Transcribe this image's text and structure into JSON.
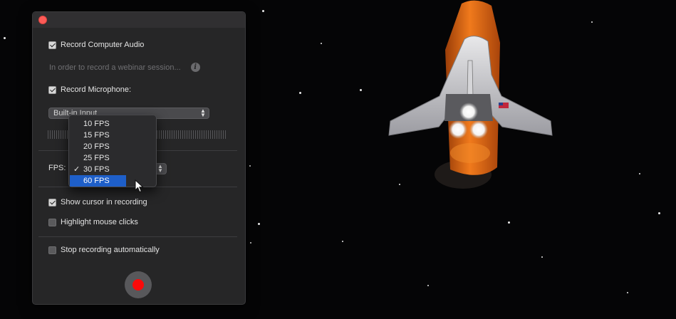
{
  "panel": {
    "record_computer_audio": {
      "label": "Record Computer Audio",
      "checked": true
    },
    "webinar_hint": "In order to record a webinar session...",
    "record_microphone": {
      "label": "Record Microphone:",
      "checked": true
    },
    "mic_input": {
      "value": "Built-in Input"
    },
    "fps": {
      "label": "FPS:",
      "options": [
        "10 FPS",
        "15 FPS",
        "20 FPS",
        "25 FPS",
        "30 FPS",
        "60 FPS"
      ],
      "checked_option": "30 FPS",
      "highlighted_option": "60 FPS"
    },
    "show_cursor": {
      "label": "Show cursor in recording",
      "checked": true
    },
    "highlight_clicks": {
      "label": "Highlight mouse clicks",
      "checked": false
    },
    "stop_automatically": {
      "label": "Stop recording automatically",
      "checked": false
    }
  },
  "icons": {
    "close": "close-icon",
    "info": "info-icon",
    "checkmark": "checkmark-icon",
    "record": "record-icon",
    "cursor": "mouse-pointer-icon",
    "select_arrows": "up-down-chevron-icon"
  },
  "colors": {
    "panel_bg": "#262627",
    "record_red": "#fb0a0a",
    "menu_highlight": "#1e5fc9",
    "close_red": "#fc5b57"
  }
}
